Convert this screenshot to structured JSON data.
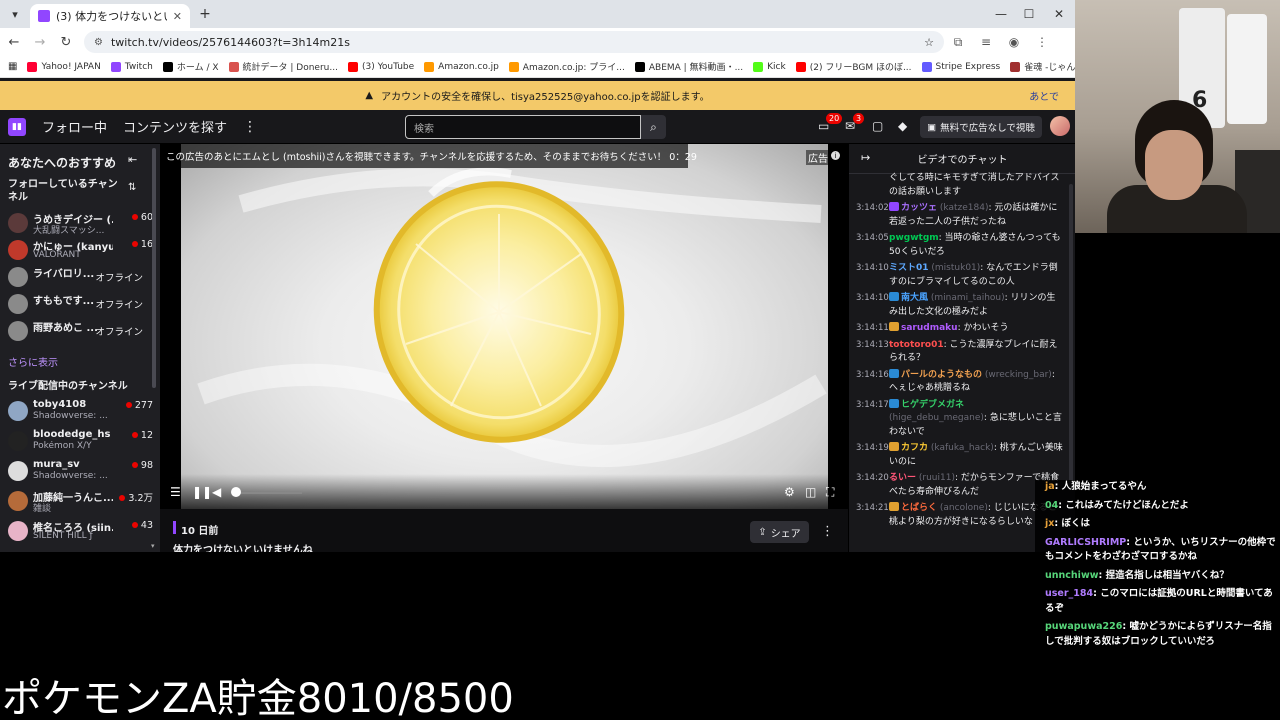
{
  "browser": {
    "tab_title": "(3) 体力をつけないといけませんね",
    "url": "twitch.tv/videos/2576144603?t=3h14m21s",
    "bookmarks": [
      {
        "label": "Yahoo! JAPAN",
        "color": "#ff0033"
      },
      {
        "label": "Twitch",
        "color": "#9146ff"
      },
      {
        "label": "ホーム / X",
        "color": "#000000"
      },
      {
        "label": "統計データ | Doneru...",
        "color": "#d9534f"
      },
      {
        "label": "(3) YouTube",
        "color": "#ff0000"
      },
      {
        "label": "Amazon.co.jp",
        "color": "#ff9900"
      },
      {
        "label": "Amazon.co.jp: プライ...",
        "color": "#ff9900"
      },
      {
        "label": "ABEMA | 無料動画・...",
        "color": "#000000"
      },
      {
        "label": "Kick",
        "color": "#53fc18"
      },
      {
        "label": "(2) フリーBGM ほのぼ...",
        "color": "#ff0000"
      },
      {
        "label": "Stripe Express",
        "color": "#635bff"
      },
      {
        "label": "雀魂 -じゃんたま- | 麻...",
        "color": "#a03030"
      }
    ]
  },
  "notice": {
    "text": "アカウントの安全を確保し、tisya252525@yahoo.co.jpを認証します。",
    "later": "あとで"
  },
  "topnav": {
    "following": "フォロー中",
    "browse": "コンテンツを探す",
    "search_placeholder": "検索",
    "notif_count": "20",
    "inbox_count": "3",
    "adfree_label": "無料で広告なしで視聴"
  },
  "sidebar": {
    "title": "あなたへのおすすめ",
    "followed_header": "フォローしているチャンネル",
    "followed": [
      {
        "name": "うめきデイジー (...",
        "game": "大乱闘スマッシ...",
        "viewers": "60",
        "avatar": "#5b3a3a"
      },
      {
        "name": "かにゅー (kanyu...",
        "game": "VALORANT",
        "viewers": "16",
        "avatar": "#c0392b"
      },
      {
        "name": "ライバロリ...",
        "game": "",
        "offline": "オフライン",
        "avatar": "#8a8a8a"
      },
      {
        "name": "すももです...",
        "game": "",
        "offline": "オフライン",
        "avatar": "#8a8a8a"
      },
      {
        "name": "雨野あめこ ...",
        "game": "",
        "offline": "オフライン",
        "avatar": "#8a8a8a"
      }
    ],
    "show_more": "さらに表示",
    "live_header": "ライブ配信中のチャンネル",
    "live": [
      {
        "name": "toby4108",
        "game": "Shadowverse: ...",
        "viewers": "277",
        "avatar": "#8fa6c4"
      },
      {
        "name": "bloodedge_hs",
        "game": "Pokémon X/Y",
        "viewers": "12",
        "avatar": "#222222"
      },
      {
        "name": "mura_sv",
        "game": "Shadowverse: ...",
        "viewers": "98",
        "avatar": "#dddddd"
      },
      {
        "name": "加藤純一うんこ...",
        "game": "雑談",
        "viewers": "3.2万",
        "avatar": "#b56b3a"
      },
      {
        "name": "椎名ころろ (siin...",
        "game": "SILENT HILL ƒ",
        "viewers": "43",
        "avatar": "#e8b4c8"
      }
    ]
  },
  "player": {
    "ad_banner": "この広告のあとにエムとし (mtoshii)さんを視聴できます。チャンネルを応援するため、そのままでお待ちください！ 0：29",
    "ad_label": "広告",
    "volume_level": 0.03
  },
  "video_info": {
    "date": "10 日前",
    "title": "体力をつけないといけませんね",
    "share_label": "シェア"
  },
  "chat": {
    "title": "ビデオでのチャット",
    "messages": [
      {
        "ts": "",
        "user": "",
        "alt": "",
        "color": "#efeff1",
        "text": "ぐしてる時にキモすぎて消したアドバイスの話お願いします"
      },
      {
        "ts": "3:14:02",
        "user": "カッツェ",
        "alt": "(katze184)",
        "color": "#a970ff",
        "badge": "#9146ff",
        "text": ": 元の話は確かに若返った二人の子供だったね"
      },
      {
        "ts": "3:14:05",
        "user": "pwgwtgm",
        "alt": "",
        "color": "#00c853",
        "text": ": 当時の爺さん婆さんつっても50くらいだろ"
      },
      {
        "ts": "3:14:10",
        "user": "ミスト01",
        "alt": "(mistuk01)",
        "color": "#5ea9ff",
        "text": ": なんでエンドラ倒すのにブラマイしてるのこの人"
      },
      {
        "ts": "3:14:10",
        "user": "南大風",
        "alt": "(minami_taihou)",
        "color": "#4aa3ff",
        "badge": "#2a8ad4",
        "text": ": リリンの生み出した文化の極みだよ"
      },
      {
        "ts": "3:14:11",
        "user": "sarudmaku",
        "alt": "",
        "color": "#b05cff",
        "badge": "#e0a030",
        "text": ": かわいそう"
      },
      {
        "ts": "3:14:13",
        "user": "tototoro01",
        "alt": "",
        "color": "#ff4f4f",
        "text": ": こうた濃厚なプレイに耐えられる？"
      },
      {
        "ts": "3:14:16",
        "user": "パールのようなもの",
        "alt": "(wrecking_bar)",
        "color": "#f0a050",
        "badge": "#2a8ad4",
        "text": ": へぇじゃあ桃贈るね"
      },
      {
        "ts": "3:14:17",
        "user": "ヒゲデブメガネ",
        "alt": "(hige_debu_megane)",
        "color": "#35d06a",
        "badge": "#2a8ad4",
        "text": ": 急に悲しいこと言わないで"
      },
      {
        "ts": "3:14:19",
        "user": "カフカ",
        "alt": "(kafuka_hack)",
        "color": "#ffcc33",
        "badge": "#e0a030",
        "text": ": 桃すんごい美味いのに"
      },
      {
        "ts": "3:14:20",
        "user": "るいー",
        "alt": "(ruui11)",
        "color": "#ff5577",
        "text": ": だからモンファーで桃食べたら寿命伸びるんだ"
      },
      {
        "ts": "3:14:21",
        "user": "とばらく",
        "alt": "(ancolone)",
        "color": "#ff6b3d",
        "badge": "#e0a030",
        "text": ": じじいになると桃より梨の方が好きになるらしいな"
      }
    ]
  },
  "overlay_chat": [
    {
      "user": "ja",
      "color": "#e8a23a",
      "text": ": 人狼始まってるやん"
    },
    {
      "user": "04",
      "color": "#57d67a",
      "text": ": これはみてたけどほんとだよ"
    },
    {
      "user": "jx",
      "color": "#e8a23a",
      "text": ": ぼくは"
    },
    {
      "user": "GARLICSHRIMP",
      "color": "#b07cff",
      "text": ": というか、いちリスナーの他枠でもコメントをわざわざマロするかね"
    },
    {
      "user": "unnchiww",
      "color": "#57d67a",
      "text": ": 捏造名指しは相当ヤバくね？"
    },
    {
      "user": "user_184",
      "color": "#b07cff",
      "text": ": このマロには証拠のURLと時間書いてあるぞ"
    },
    {
      "user": "puwapuwa226",
      "color": "#57d67a",
      "text": ": 嘘かどうかによらずリスナー名指しで批判する奴はブロックしていいだろ"
    }
  ],
  "webcam": {
    "shirt_number": "6"
  },
  "goal_text": "ポケモンZA貯金8010/8500"
}
